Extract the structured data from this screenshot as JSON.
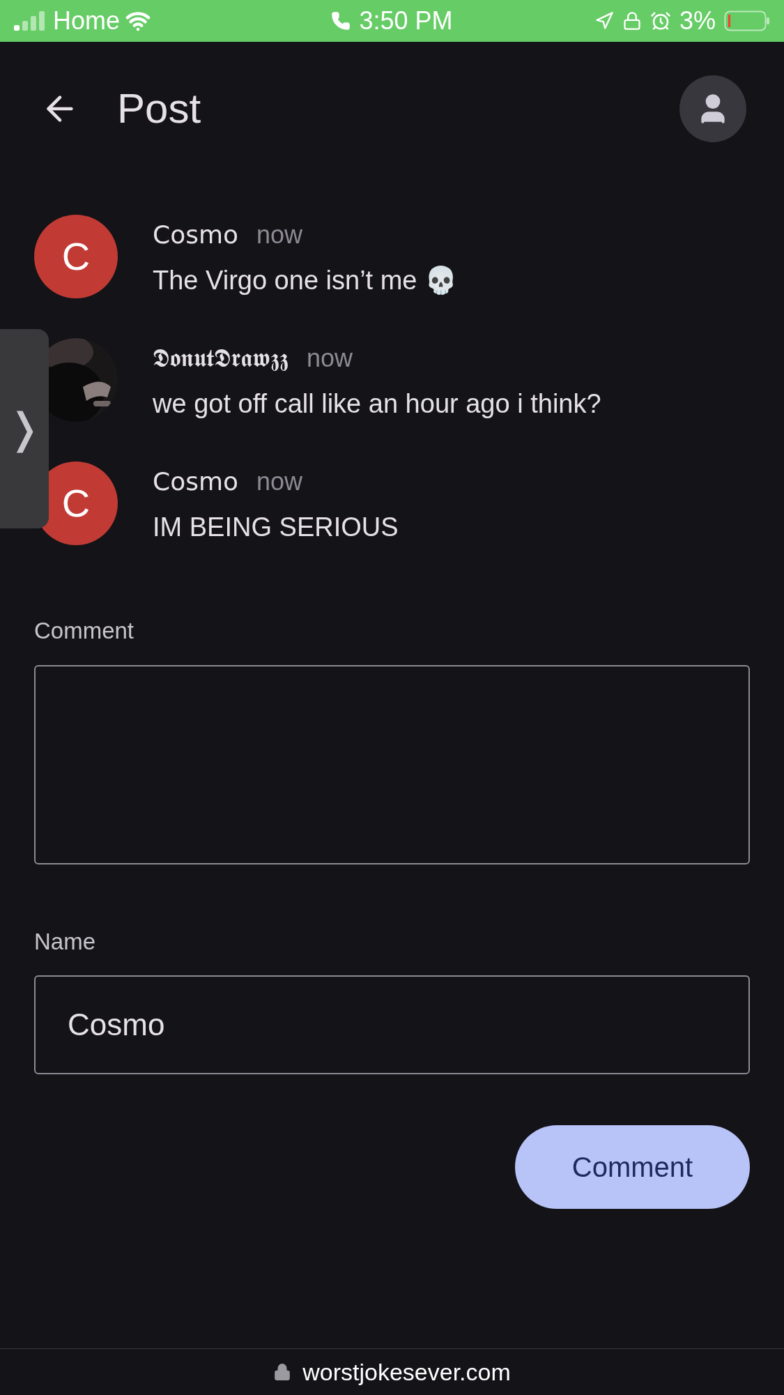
{
  "status_bar": {
    "carrier": "Home",
    "time": "3:50 PM",
    "battery": "3%"
  },
  "header": {
    "title": "Post"
  },
  "comments": [
    {
      "author": "Cosmo",
      "avatar": {
        "kind": "letter",
        "letter": "C"
      },
      "time": "now",
      "text": "The Virgo one isn’t me 💀"
    },
    {
      "author": "𝕯𝖔𝖓𝖚𝖙𝕯𝖗𝖆𝖜𝖟𝖟",
      "time": "now",
      "text": "we got off call like an hour ago i think?"
    },
    {
      "author": "Cosmo",
      "avatar": {
        "kind": "letter",
        "letter": "C"
      },
      "time": "now",
      "text": "IM BEING SERIOUS"
    }
  ],
  "side_tab": {
    "glyph": "❭"
  },
  "form": {
    "comment_label": "Comment",
    "name_label": "Name",
    "name_value": "Cosmo",
    "submit": "Comment"
  },
  "url_bar": {
    "url": "worstjokesever.com"
  }
}
